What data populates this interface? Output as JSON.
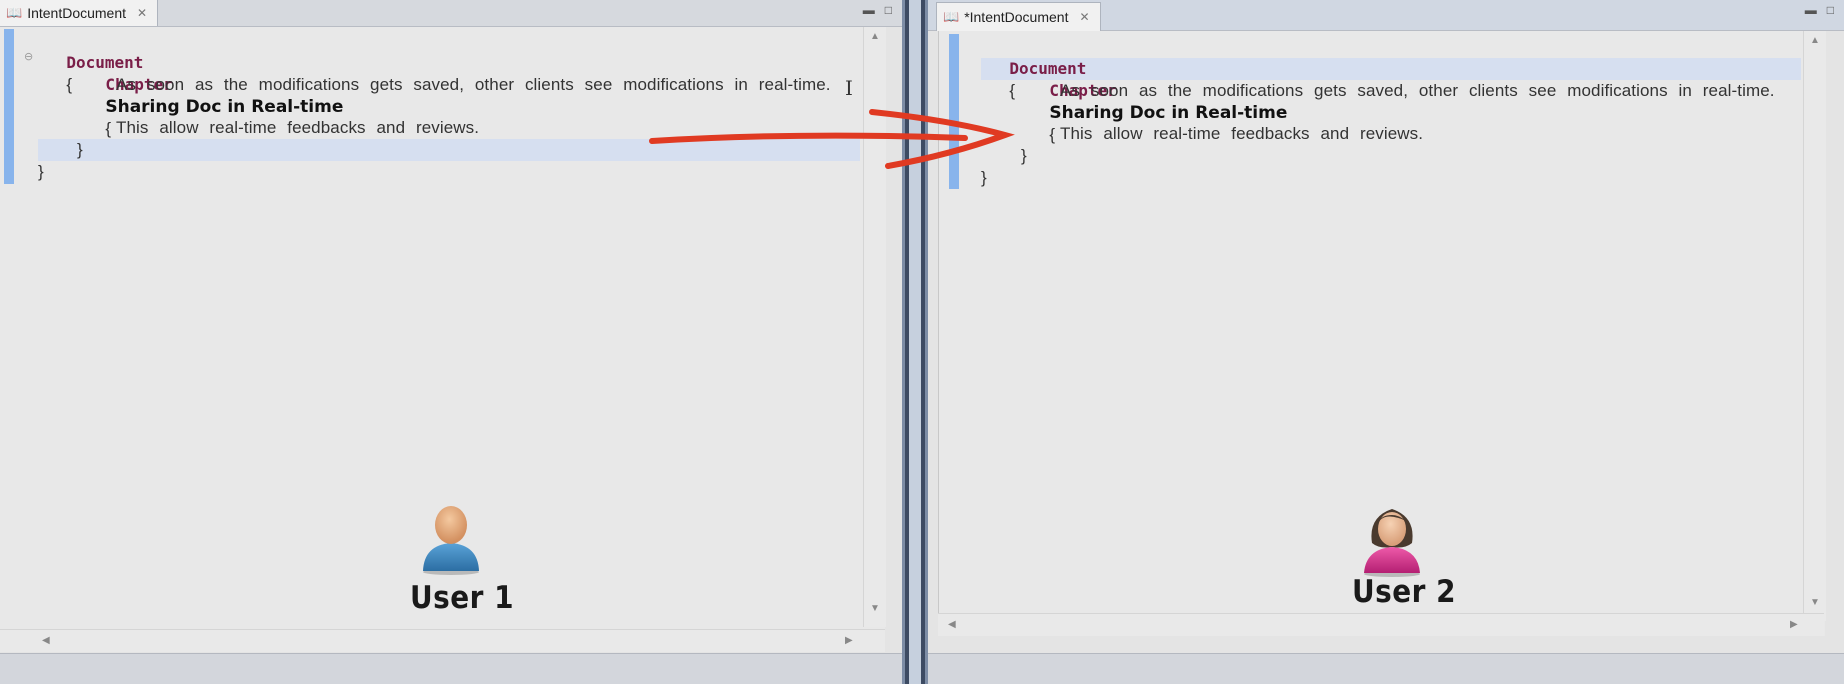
{
  "left_editor": {
    "tab_title": "IntentDocument",
    "doc_keyword": "Document",
    "chapter_keyword": "Chapter",
    "chapter_title": "Sharing Doc in Real-time",
    "open_brace": "{",
    "close_brace": "}",
    "line1": "As soon as the modifications gets saved, other clients see modifications in real-time.",
    "line2": "This allow real-time feedbacks and reviews.",
    "user_label": "User 1"
  },
  "right_editor": {
    "tab_title": "*IntentDocument",
    "doc_keyword": "Document",
    "chapter_keyword": "Chapter",
    "chapter_title": "Sharing Doc in Real-time",
    "open_brace": "{",
    "close_brace": "}",
    "line1": "As soon as the modifications gets saved, other clients see modifications in real-time.",
    "line2": "This allow real-time feedbacks and reviews.",
    "user_label": "User 2"
  },
  "icons": {
    "tab": "book-icon",
    "close": "close-icon",
    "minimize": "minimize-icon",
    "maximize": "maximize-icon",
    "collapse": "collapse-icon",
    "user1": "male-user-icon",
    "user2": "female-user-icon",
    "arrow": "sync-arrow-icon"
  },
  "colors": {
    "keyword": "#7a1e48",
    "highlight": "#d6dff0",
    "gutter": "#88b4ec",
    "arrow": "#e03a22",
    "user1": "#3f8cc6",
    "user2": "#d9348f"
  }
}
